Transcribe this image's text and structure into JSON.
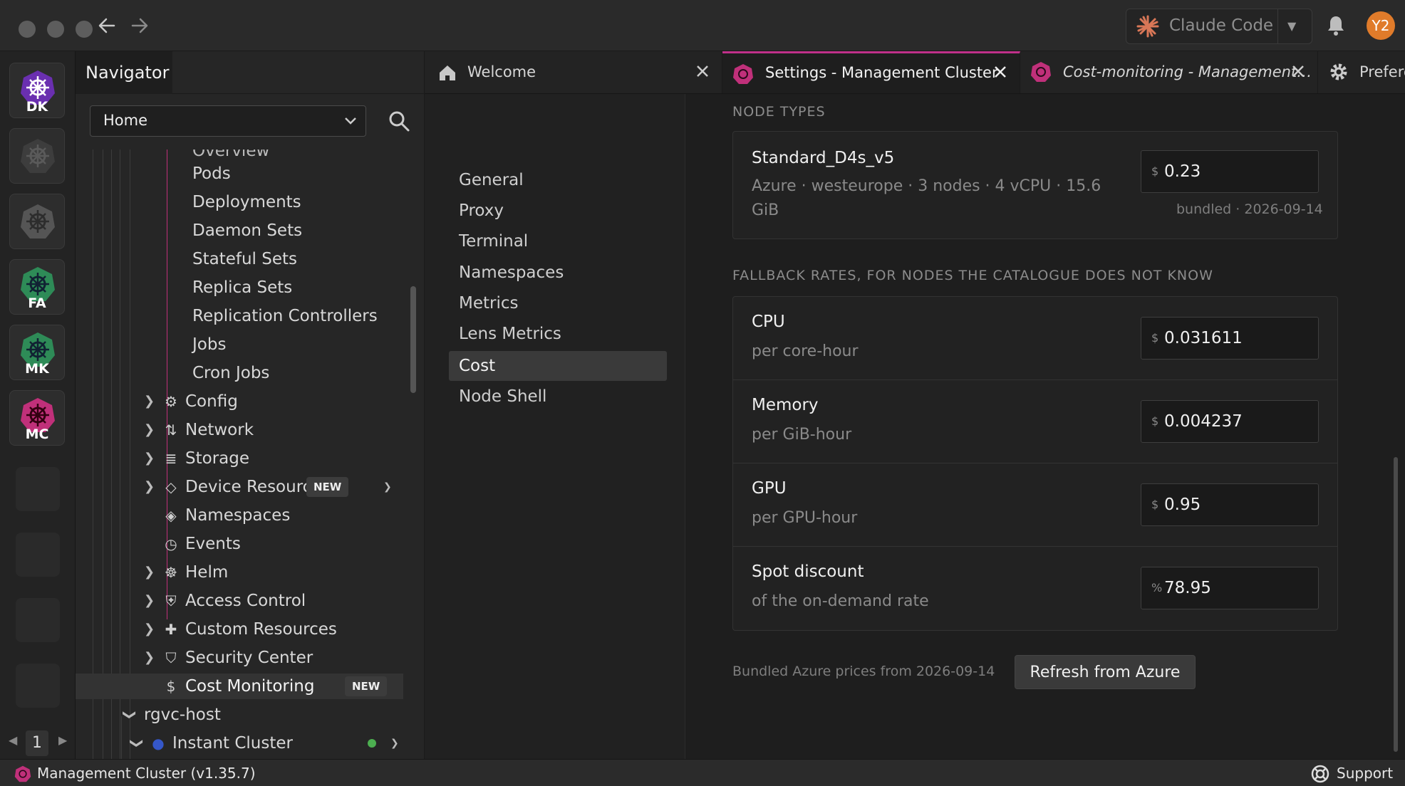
{
  "titlebar": {
    "back_icon": "arrow-left-icon",
    "forward_icon": "arrow-right-icon",
    "assistant_label": "Claude Code",
    "assistant_icon": "claude-star-icon",
    "bell_icon": "bell-icon",
    "avatar_initials": "Y2",
    "avatar_color": "#e07b2a"
  },
  "hotbar": {
    "items": [
      {
        "label": "DK",
        "color": "#6a2fb0"
      },
      {
        "label": "",
        "color": "#3d3d3d"
      },
      {
        "label": "",
        "color": "#4a4a4a"
      },
      {
        "label": "FA",
        "color": "#2e8b57"
      },
      {
        "label": "MK",
        "color": "#2e8b57"
      },
      {
        "label": "MC",
        "color": "#c0307a"
      }
    ],
    "page": "1"
  },
  "navigator": {
    "title": "Navigator",
    "context": "Home",
    "search_icon": "search-icon",
    "workloads": [
      "Overview",
      "Pods",
      "Deployments",
      "Daemon Sets",
      "Stateful Sets",
      "Replica Sets",
      "Replication Controllers",
      "Jobs",
      "Cron Jobs"
    ],
    "groups": [
      {
        "label": "Config",
        "icon": "config-icon"
      },
      {
        "label": "Network",
        "icon": "network-icon"
      },
      {
        "label": "Storage",
        "icon": "storage-icon"
      },
      {
        "label": "Device Resources",
        "icon": "device-icon",
        "badge": "NEW"
      },
      {
        "label": "Namespaces",
        "icon": "layers-icon"
      },
      {
        "label": "Events",
        "icon": "clock-icon"
      },
      {
        "label": "Helm",
        "icon": "helm-icon"
      },
      {
        "label": "Access Control",
        "icon": "shield-icon"
      },
      {
        "label": "Custom Resources",
        "icon": "puzzle-icon"
      },
      {
        "label": "Security Center",
        "icon": "security-icon"
      },
      {
        "label": "Cost Monitoring",
        "icon": "dollar-icon",
        "badge": "NEW"
      }
    ],
    "host": "rgvc-host",
    "instant_cluster": "Instant Cluster",
    "status_color": "#4caf50"
  },
  "tabs": [
    {
      "label": "Welcome",
      "icon": "home-icon"
    },
    {
      "label": "Settings - Management Cluster",
      "icon": "cluster-icon"
    },
    {
      "label": "Cost-monitoring - Management…",
      "icon": "cluster-icon"
    },
    {
      "label": "Prefere",
      "icon": "gear-icon"
    }
  ],
  "settings_nav": [
    "General",
    "Proxy",
    "Terminal",
    "Namespaces",
    "Metrics",
    "Lens Metrics",
    "Cost",
    "Node Shell"
  ],
  "cost": {
    "node_types_title": "NODE TYPES",
    "node": {
      "name": "Standard_D4s_v5",
      "details": "Azure · westeurope · 3 nodes · 4 vCPU · 15.6 GiB",
      "currency": "$",
      "price": "0.23",
      "note": "bundled · 2026-09-14"
    },
    "fallback_title": "FALLBACK RATES, FOR NODES THE CATALOGUE DOES NOT KNOW",
    "rates": [
      {
        "name": "CPU",
        "unit": "per core-hour",
        "prefix": "$",
        "value": "0.031611"
      },
      {
        "name": "Memory",
        "unit": "per GiB-hour",
        "prefix": "$",
        "value": "0.004237"
      },
      {
        "name": "GPU",
        "unit": "per GPU-hour",
        "prefix": "$",
        "value": "0.95"
      },
      {
        "name": "Spot discount",
        "unit": "of the on-demand rate",
        "prefix": "%",
        "value": "78.95"
      }
    ],
    "footer_note": "Bundled Azure prices from 2026-09-14",
    "refresh_label": "Refresh from Azure"
  },
  "statusbar": {
    "cluster": "Management Cluster (v1.35.7)",
    "support": "Support",
    "support_icon": "lifebuoy-icon"
  },
  "colors": {
    "accent": "#c0308a",
    "background": "#1e1e1e"
  }
}
